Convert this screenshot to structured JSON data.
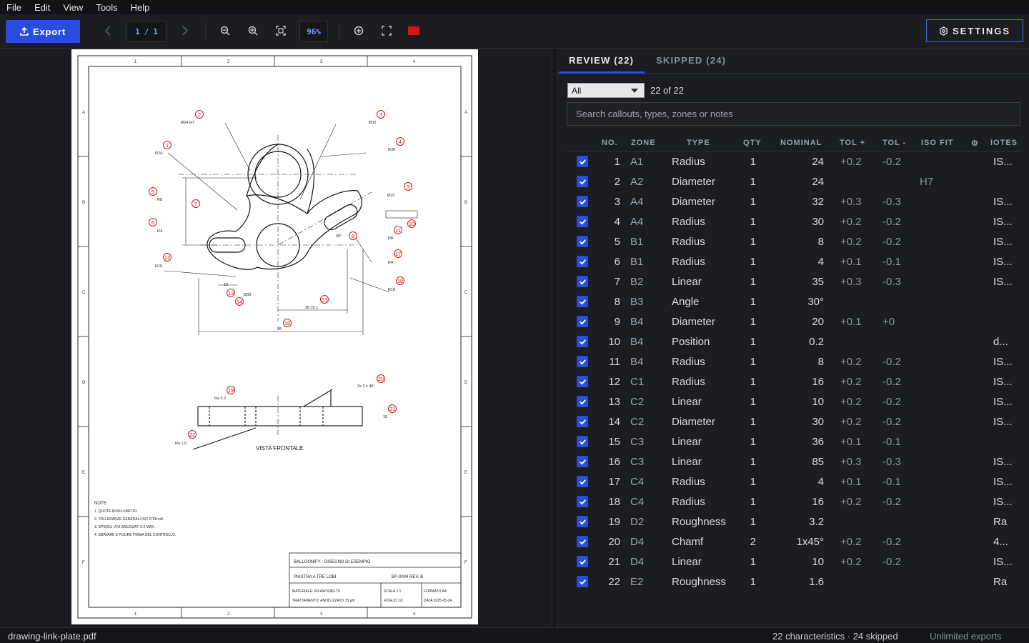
{
  "menu": [
    "File",
    "Edit",
    "View",
    "Tools",
    "Help"
  ],
  "toolbar": {
    "export_label": "Export",
    "page_current": "1",
    "page_sep": "/",
    "page_total": "1",
    "zoom": "96%",
    "annotation_color": "#e01010",
    "settings_label": "SETTINGS"
  },
  "tabs": {
    "review": "REVIEW (22)",
    "skipped": "SKIPPED (24)"
  },
  "filter": {
    "value": "All",
    "count": "22 of 22"
  },
  "search": {
    "placeholder": "Search callouts, types, zones or notes"
  },
  "columns": {
    "no": "NO.",
    "zone": "ZONE",
    "type": "TYPE",
    "qty": "QTY",
    "nominal": "NOMINAL",
    "tolp": "TOL +",
    "tolm": "TOL -",
    "iso": "ISO FIT",
    "sym": "⚙",
    "notes": "IOTES"
  },
  "rows": [
    {
      "no": "1",
      "zone": "A1",
      "type": "Radius",
      "qty": "1",
      "nominal": "24",
      "tolp": "+0.2",
      "tolm": "-0.2",
      "iso": "",
      "notes": "IS..."
    },
    {
      "no": "2",
      "zone": "A2",
      "type": "Diameter",
      "qty": "1",
      "nominal": "24",
      "tolp": "",
      "tolm": "",
      "iso": "H7",
      "notes": ""
    },
    {
      "no": "3",
      "zone": "A4",
      "type": "Diameter",
      "qty": "1",
      "nominal": "32",
      "tolp": "+0.3",
      "tolm": "-0.3",
      "iso": "",
      "notes": "IS..."
    },
    {
      "no": "4",
      "zone": "A4",
      "type": "Radius",
      "qty": "1",
      "nominal": "30",
      "tolp": "+0.2",
      "tolm": "-0.2",
      "iso": "",
      "notes": "IS..."
    },
    {
      "no": "5",
      "zone": "B1",
      "type": "Radius",
      "qty": "1",
      "nominal": "8",
      "tolp": "+0.2",
      "tolm": "-0.2",
      "iso": "",
      "notes": "IS..."
    },
    {
      "no": "6",
      "zone": "B1",
      "type": "Radius",
      "qty": "1",
      "nominal": "4",
      "tolp": "+0.1",
      "tolm": "-0.1",
      "iso": "",
      "notes": "IS..."
    },
    {
      "no": "7",
      "zone": "B2",
      "type": "Linear",
      "qty": "1",
      "nominal": "35",
      "tolp": "+0.3",
      "tolm": "-0.3",
      "iso": "",
      "notes": "IS..."
    },
    {
      "no": "8",
      "zone": "B3",
      "type": "Angle",
      "qty": "1",
      "nominal": "30°",
      "tolp": "",
      "tolm": "",
      "iso": "",
      "notes": ""
    },
    {
      "no": "9",
      "zone": "B4",
      "type": "Diameter",
      "qty": "1",
      "nominal": "20",
      "tolp": "+0.1",
      "tolm": "+0",
      "iso": "",
      "notes": ""
    },
    {
      "no": "10",
      "zone": "B4",
      "type": "Position",
      "qty": "1",
      "nominal": "0.2",
      "tolp": "",
      "tolm": "",
      "iso": "",
      "notes": "d..."
    },
    {
      "no": "11",
      "zone": "B4",
      "type": "Radius",
      "qty": "1",
      "nominal": "8",
      "tolp": "+0.2",
      "tolm": "-0.2",
      "iso": "",
      "notes": "IS..."
    },
    {
      "no": "12",
      "zone": "C1",
      "type": "Radius",
      "qty": "1",
      "nominal": "16",
      "tolp": "+0.2",
      "tolm": "-0.2",
      "iso": "",
      "notes": "IS..."
    },
    {
      "no": "13",
      "zone": "C2",
      "type": "Linear",
      "qty": "1",
      "nominal": "10",
      "tolp": "+0.2",
      "tolm": "-0.2",
      "iso": "",
      "notes": "IS..."
    },
    {
      "no": "14",
      "zone": "C2",
      "type": "Diameter",
      "qty": "1",
      "nominal": "30",
      "tolp": "+0.2",
      "tolm": "-0.2",
      "iso": "",
      "notes": "IS..."
    },
    {
      "no": "15",
      "zone": "C3",
      "type": "Linear",
      "qty": "1",
      "nominal": "36",
      "tolp": "+0.1",
      "tolm": "-0.1",
      "iso": "",
      "notes": ""
    },
    {
      "no": "16",
      "zone": "C3",
      "type": "Linear",
      "qty": "1",
      "nominal": "85",
      "tolp": "+0.3",
      "tolm": "-0.3",
      "iso": "",
      "notes": "IS..."
    },
    {
      "no": "17",
      "zone": "C4",
      "type": "Radius",
      "qty": "1",
      "nominal": "4",
      "tolp": "+0.1",
      "tolm": "-0.1",
      "iso": "",
      "notes": "IS..."
    },
    {
      "no": "18",
      "zone": "C4",
      "type": "Radius",
      "qty": "1",
      "nominal": "16",
      "tolp": "+0.2",
      "tolm": "-0.2",
      "iso": "",
      "notes": "IS..."
    },
    {
      "no": "19",
      "zone": "D2",
      "type": "Roughness",
      "qty": "1",
      "nominal": "3.2",
      "tolp": "",
      "tolm": "",
      "iso": "",
      "notes": "Ra"
    },
    {
      "no": "20",
      "zone": "D4",
      "type": "Chamf",
      "qty": "2",
      "nominal": "1x45°",
      "tolp": "+0.2",
      "tolm": "-0.2",
      "iso": "",
      "notes": "4..."
    },
    {
      "no": "21",
      "zone": "D4",
      "type": "Linear",
      "qty": "1",
      "nominal": "10",
      "tolp": "+0.2",
      "tolm": "-0.2",
      "iso": "",
      "notes": "IS..."
    },
    {
      "no": "22",
      "zone": "E2",
      "type": "Roughness",
      "qty": "1",
      "nominal": "1.6",
      "tolp": "",
      "tolm": "",
      "iso": "",
      "notes": "Ra"
    }
  ],
  "drawing": {
    "view_label": "VISTA FRONTALE",
    "notes_title": "NOTE:",
    "notes_lines": [
      "1. QUOTE IN MILLIMETRI.",
      "2. TOLLERANZE GENERALI ISO 2768-mK.",
      "3. SPIGOLI VIVI SMUSSATI 0.2 MAX.",
      "4. SBAVARE E PULIRE PRIMA DEL CONTROLLO."
    ],
    "tb_company": "BALLOONIFY · DISEGNO DI ESEMPIO",
    "tb_title": "PIASTRA A TRE LOBI",
    "tb_partno": "BP-0004 REV. B",
    "tb_material": "MATERIALE: EN AW-6082-T6",
    "tb_treatment": "TRATTAMENTO: ANOD.IZZATO 15 µm",
    "tb_scale": "SCALA 1:1",
    "tb_sheet": "FOGLIO 1/1",
    "tb_format": "FORMATO A4",
    "tb_date": "DATA 2025-05-24",
    "zone_cols": [
      "1",
      "2",
      "3",
      "4"
    ],
    "zone_rows": [
      "A",
      "B",
      "C",
      "D",
      "E",
      "F"
    ],
    "balloons": [
      "1",
      "2",
      "3",
      "4",
      "5",
      "6",
      "7",
      "8",
      "9",
      "10",
      "11",
      "12",
      "13",
      "14",
      "15",
      "16",
      "17",
      "18",
      "19",
      "20",
      "21",
      "22"
    ],
    "dim_texts": [
      "Ø24 H7",
      "Ø32",
      "R30",
      "R24",
      "R8",
      "R4",
      "Ø20",
      "30°",
      "R8",
      "R16",
      "R4",
      "R16",
      "10",
      "Ø30",
      "36 ±0.1",
      "85",
      "Ra 3.2",
      "2x 1 x 45°",
      "10",
      "Ra 1.6"
    ]
  },
  "status": {
    "file": "drawing-link-plate.pdf",
    "summary": "22 characteristics  ·  24 skipped",
    "exports": "Unlimited exports"
  }
}
